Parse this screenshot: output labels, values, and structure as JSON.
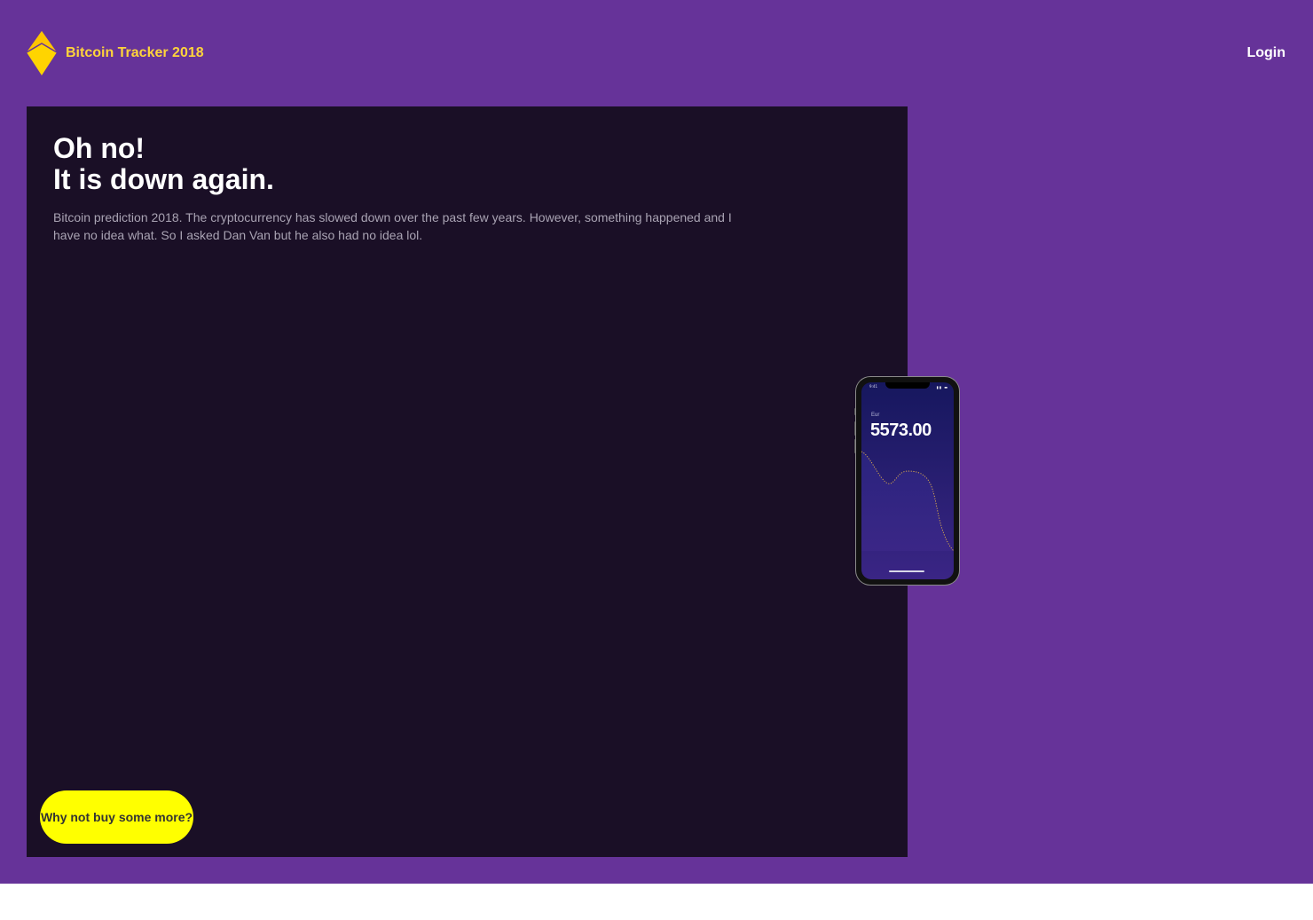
{
  "header": {
    "brand": "Bitcoin Tracker 2018",
    "login": "Login"
  },
  "hero": {
    "headline_line1": "Oh no!",
    "headline_line2": "It is down again.",
    "description": "Bitcoin prediction 2018. The cryptocurrency has slowed down over the past few years. However, something happened and I have no idea what. So I asked Dan Van but he also had no idea lol.",
    "cta": "Why not buy some more?"
  },
  "phone": {
    "status_time": "9:41",
    "status_icons": "▮▮ ▬",
    "currency": "Eur",
    "price": "5573.00"
  },
  "colors": {
    "background": "#663399",
    "panel": "#1a0f26",
    "brand": "#ffd43b",
    "cta": "#ffff00"
  }
}
